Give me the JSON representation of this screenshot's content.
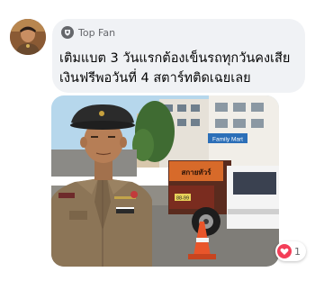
{
  "comment": {
    "badge_icon": "top-fan-icon",
    "badge_label": "Top Fan",
    "text_lines": [
      "เติมแบต 3 วันแรกต้องเข็นรถทุกวันคงเสีย",
      "เงินฟรีพอวันที่ 4 สตาร์ทติดเฉยเลย"
    ]
  },
  "photo": {
    "banner_text": "สกายทัวร์",
    "sign_text": "Family Mart",
    "plate_text": "88-99"
  },
  "reaction": {
    "icon": "heart-reaction-icon",
    "count": "1"
  },
  "colors": {
    "bubble_bg": "#f0f2f5",
    "reaction_heart": "#f33e58",
    "badge_icon": "#65676b"
  }
}
